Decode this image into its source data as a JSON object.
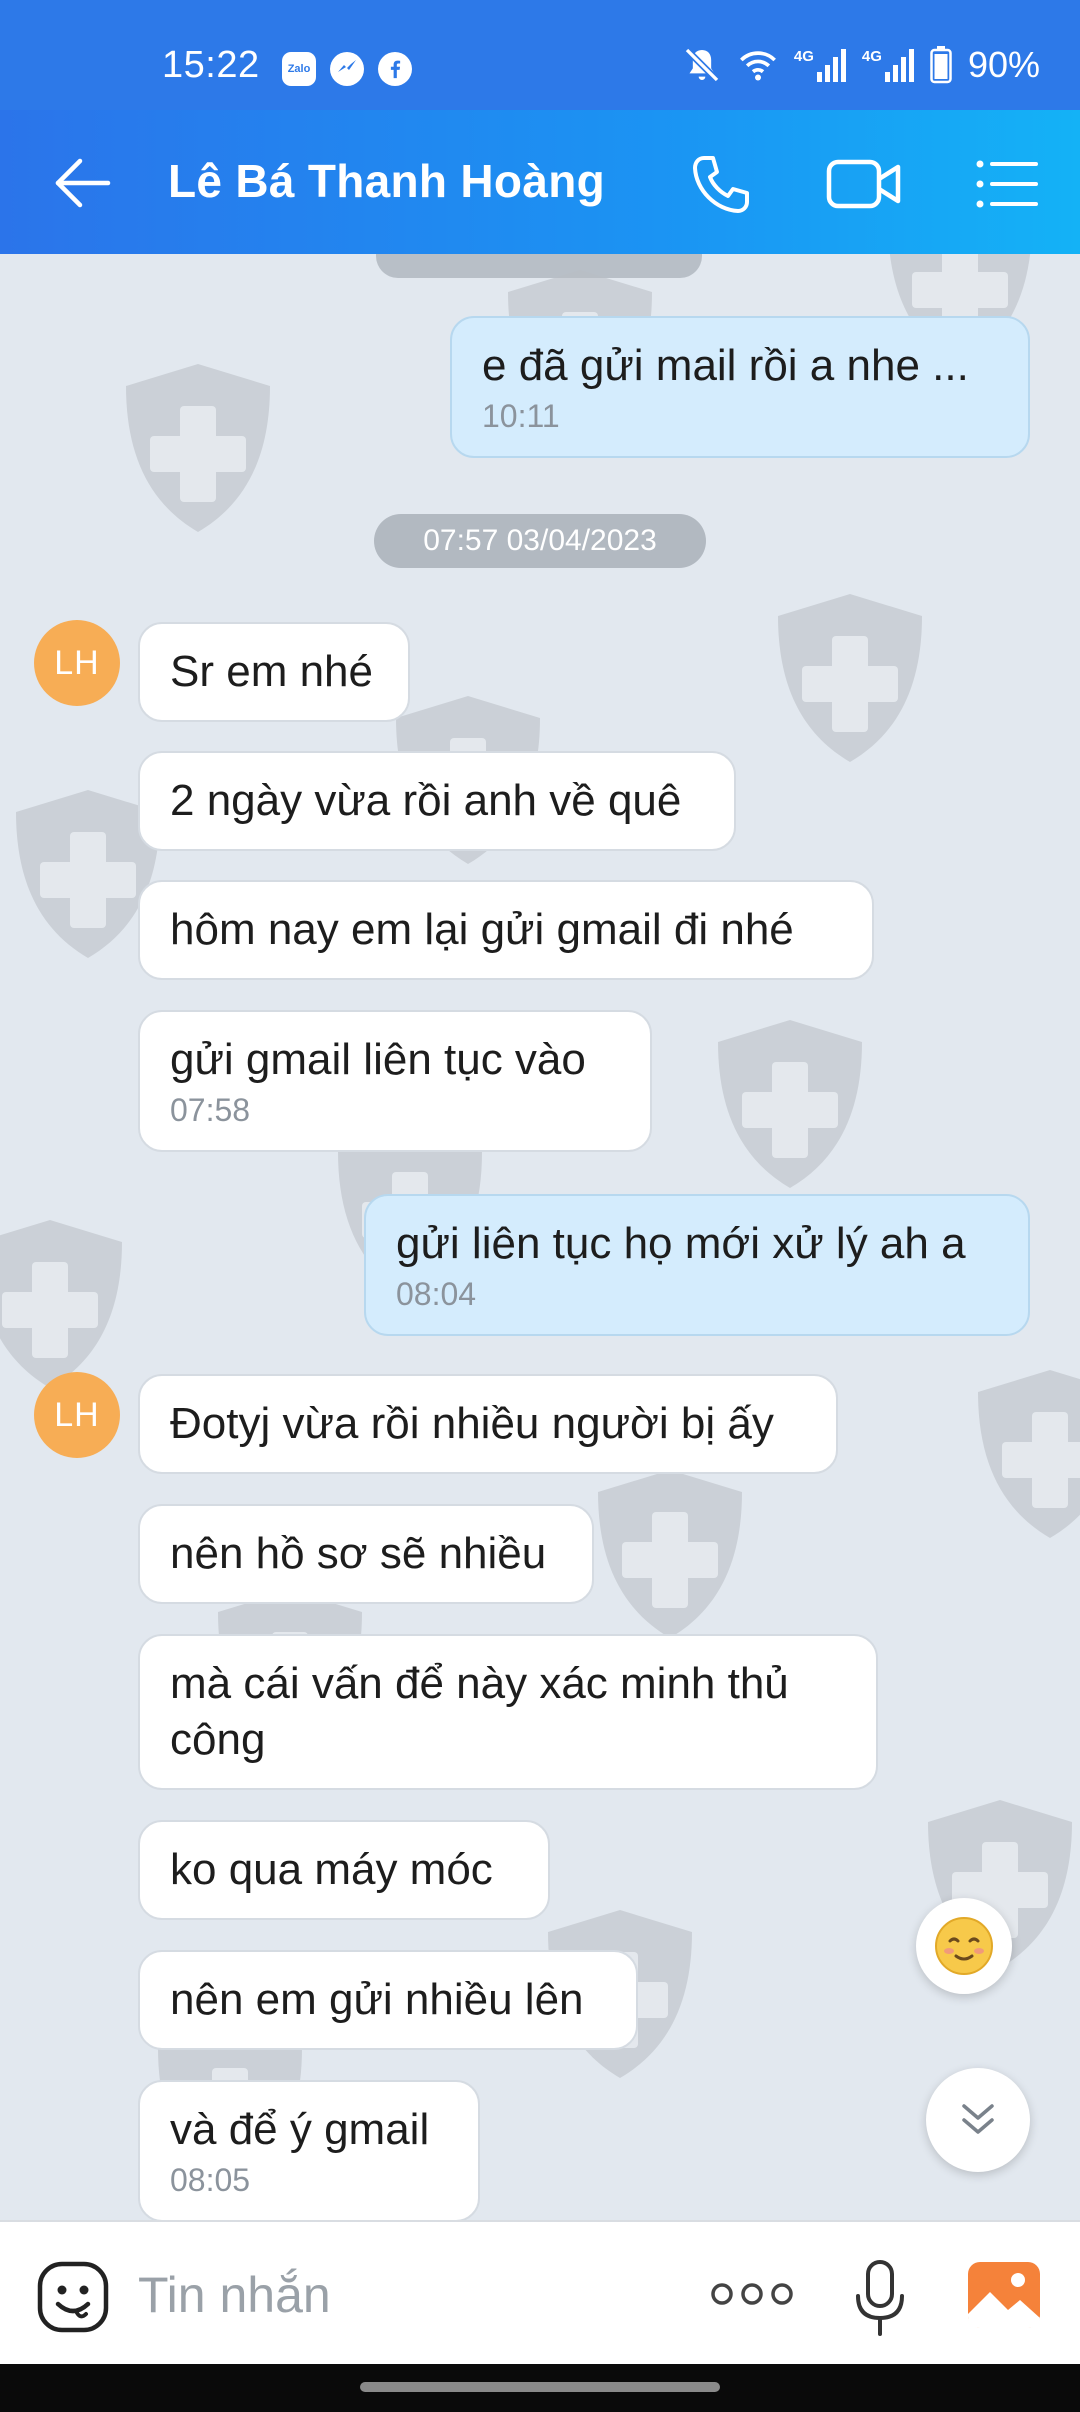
{
  "status_bar": {
    "time": "15:22",
    "app_icons": [
      "zalo-icon",
      "messenger-icon",
      "facebook-icon"
    ],
    "zalo_label": "Zalo",
    "signal_1": "4G",
    "signal_2": "4G",
    "battery": "90%"
  },
  "header": {
    "contact_name": "Lê Bá Thanh Hoàng",
    "icons": [
      "back-arrow-icon",
      "phone-icon",
      "video-call-icon",
      "menu-list-icon"
    ]
  },
  "chat": {
    "date_divider": "07:57 03/04/2023",
    "messages": [
      {
        "side": "out",
        "text": "e đã gửi mail rồi a nhe ...",
        "time": "10:11"
      },
      {
        "side": "in",
        "avatar": "LH",
        "text": "Sr em nhé"
      },
      {
        "side": "in",
        "text": "2 ngày vừa rồi anh về quê"
      },
      {
        "side": "in",
        "text": "hôm nay em lại gửi gmail đi nhé"
      },
      {
        "side": "in",
        "text": "gửi gmail liên tục vào",
        "time": "07:58"
      },
      {
        "side": "out",
        "text": "gửi liên tục họ mới xử lý ah a",
        "time": "08:04"
      },
      {
        "side": "in",
        "avatar": "LH",
        "text": "Đotyj vừa rồi nhiều người bị ấy"
      },
      {
        "side": "in",
        "text": "nên hồ sơ sẽ nhiều"
      },
      {
        "side": "in",
        "text": "mà cái vấn để này xác minh thủ công"
      },
      {
        "side": "in",
        "text": "ko qua máy móc"
      },
      {
        "side": "in",
        "text": "nên em gửi nhiều lên"
      },
      {
        "side": "in",
        "text": "và để ý gmail",
        "time": "08:05"
      }
    ],
    "floating": [
      "smile-emoji-icon",
      "scroll-down-icon"
    ]
  },
  "input_bar": {
    "placeholder": "Tin nhắn",
    "icons": [
      "emoji-icon",
      "more-icon",
      "microphone-icon",
      "image-icon"
    ]
  },
  "colors": {
    "header_start": "#2b74ea",
    "header_end": "#14b2f6",
    "status_bar": "#2d79e8",
    "chat_background": "#e2e8ef",
    "outgoing_bubble": "#d4ecfd",
    "incoming_bubble": "#ffffff",
    "avatar": "#f7ad55",
    "image_icon": "#f5823a"
  }
}
